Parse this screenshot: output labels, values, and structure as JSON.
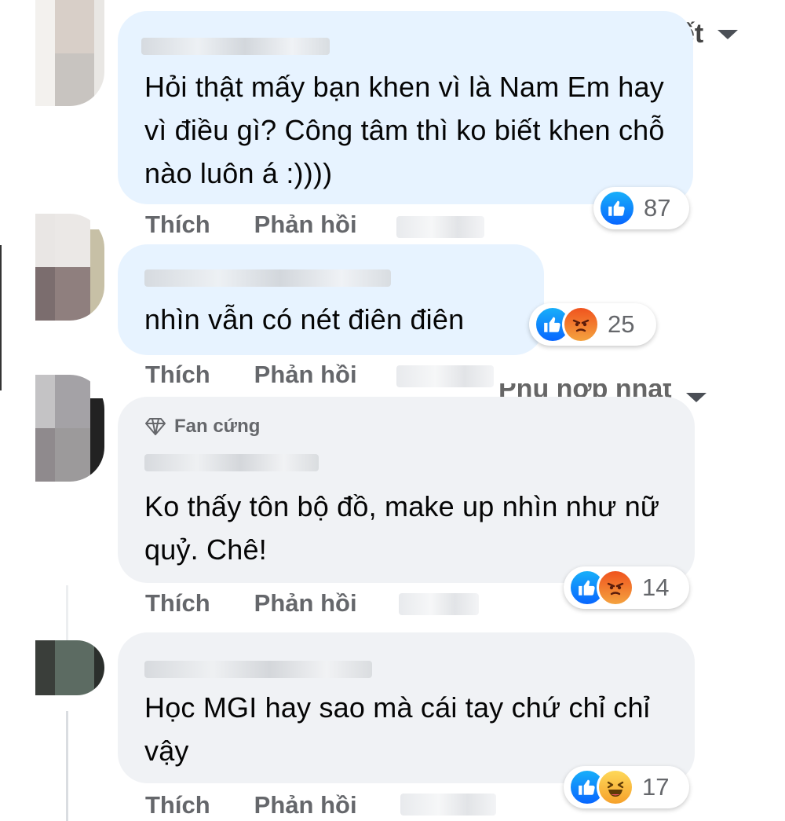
{
  "sort_label_top": "ết",
  "sort_label_mid": "Phù hợp nhất",
  "comments": [
    {
      "badge": "",
      "text": "Hỏi thật mấy bạn khen vì là Nam Em hay vì điều gì? Công tâm thì ko biết khen chỗ nào luôn á :))))",
      "reaction_count": "87",
      "actions": {
        "like": "Thích",
        "reply": "Phản hồi"
      }
    },
    {
      "badge": "",
      "text": "nhìn vẫn có nét điên điên",
      "reaction_count": "25",
      "actions": {
        "like": "Thích",
        "reply": "Phản hồi"
      }
    },
    {
      "badge": "Fan cứng",
      "text": "Ko thấy tôn bộ đồ, make up nhìn như nữ quỷ. Chê!",
      "reaction_count": "14",
      "actions": {
        "like": "Thích",
        "reply": "Phản hồi"
      }
    },
    {
      "badge": "",
      "text": "Học MGI hay sao mà cái tay chứ chỉ chỉ vậy",
      "reaction_count": "17",
      "actions": {
        "like": "Thích",
        "reply": "Phản hồi"
      }
    }
  ],
  "reaction_types": {
    "c1": [
      "like-icon"
    ],
    "c2": [
      "like-icon",
      "angry-icon"
    ],
    "c3": [
      "like-icon",
      "angry-icon"
    ],
    "c4": [
      "like-icon",
      "haha-icon"
    ]
  },
  "colors": {
    "bubble_blue": "#e7f3ff",
    "bubble_gray": "#f0f2f5",
    "like_blue": "#0866ff",
    "meta_gray": "#65676b"
  }
}
